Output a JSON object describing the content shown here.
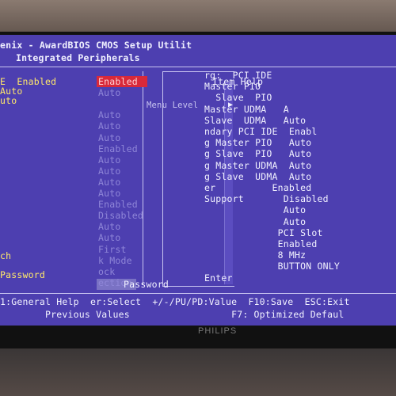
{
  "header": {
    "title": "enix - AwardBIOS CMOS Setup Utilit",
    "subtitle": "Integrated Peripherals"
  },
  "left_col": {
    "lines": [
      "E  Enabled",
      "Auto",
      "uto",
      "",
      "",
      "",
      "",
      "",
      "",
      "",
      "",
      "",
      "",
      "",
      "",
      "",
      "",
      "",
      "ch",
      "",
      "Password"
    ]
  },
  "mid_col": {
    "selected": "Enabled",
    "lines": [
      "",
      "Auto",
      "",
      "Auto",
      "Auto",
      "Auto",
      "Enabled",
      "Auto",
      "Auto",
      "Auto",
      "Auto",
      "Enabled",
      "Disabled",
      "Auto",
      "Auto",
      "First",
      "k Mode",
      "ock",
      "ection"
    ]
  },
  "help": {
    "title": "Item Help",
    "menu_level": "Menu Level",
    "arrow": "▶"
  },
  "right_lines": [
    "rg:  PCI IDE",
    "Master PIO",
    "  Slave  PIO",
    "Master UDMA   A",
    "Slave  UDMA   Auto",
    "ndary PCI IDE  Enabl",
    "g Master PIO   Auto",
    "g Slave  PIO   Auto",
    "g Master UDMA  Auto",
    "g Slave  UDMA  Auto",
    "er          Enabled",
    "Support       Disabled",
    "              Auto",
    "              Auto",
    "             PCI Slot",
    "             Enabled",
    "             8 MHz",
    "             BUTTON ONLY",
    "Enter"
  ],
  "footer": {
    "line1": "1:General Help  er:Select  +/-/PU/PD:Value  F10:Save  ESC:Exit",
    "line2": "        Previous Values                  F7: Optimized Defaul"
  },
  "brand": "PHILIPS",
  "colors": {
    "bios_bg": "#4d3fb0",
    "highlight": "#d8293a",
    "text": "#f2f2ff",
    "value_text": "#ffe86a"
  }
}
